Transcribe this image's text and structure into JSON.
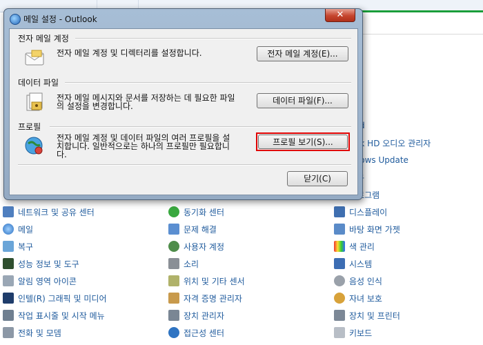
{
  "dialog": {
    "title": "메일 설정 - Outlook",
    "close_glyph": "✕",
    "sections": [
      {
        "title": "전자 메일 계정",
        "desc": [
          "전자 메일 계정 및 디렉터리를 설정합니다."
        ],
        "button": "전자 메일 계정(E)..."
      },
      {
        "title": "데이터 파일",
        "desc": [
          "전자 메일 메시지와 문서를 저장하는 데 필요한 파일",
          "의 설정을 변경합니다."
        ],
        "button": "데이터 파일(F)..."
      },
      {
        "title": "프로필",
        "desc": [
          "전자 메일 계정 및 데이터 파일의 여러 프로필을 설",
          "치합니다. 일반적으로는 하나의 프로필만 필요합니",
          "다."
        ],
        "button": "프로필 보기(S)..."
      }
    ],
    "close_button": "닫기(C)"
  },
  "control_panel": {
    "partial_items": [
      "oud",
      "ltek HD 오디오 관리자",
      "ndows Update",
      "도구",
      "프로그램"
    ],
    "columns": [
      [
        {
          "label": "네트워크 및 공유 센터",
          "icon": "network-icon"
        },
        {
          "label": "메일",
          "icon": "mail-icon"
        },
        {
          "label": "복구",
          "icon": "recovery-icon"
        },
        {
          "label": "성능 정보 및 도구",
          "icon": "performance-icon"
        },
        {
          "label": "알림 영역 아이콘",
          "icon": "notification-icon"
        },
        {
          "label": "인텔(R) 그래픽 및 미디어",
          "icon": "intel-graphics-icon"
        },
        {
          "label": "작업 표시줄 및 시작 메뉴",
          "icon": "taskbar-icon"
        },
        {
          "label": "전화 및 모뎀",
          "icon": "phone-icon"
        }
      ],
      [
        {
          "label": "동기화 센터",
          "icon": "sync-icon"
        },
        {
          "label": "문제 해결",
          "icon": "troubleshoot-icon"
        },
        {
          "label": "사용자 계정",
          "icon": "user-accounts-icon"
        },
        {
          "label": "소리",
          "icon": "sound-icon"
        },
        {
          "label": "위치 및 기타 센서",
          "icon": "sensor-icon"
        },
        {
          "label": "자격 증명 관리자",
          "icon": "credential-icon"
        },
        {
          "label": "장치 관리자",
          "icon": "device-manager-icon"
        },
        {
          "label": "접근성 센터",
          "icon": "accessibility-icon"
        }
      ],
      [
        {
          "label": "디스플레이",
          "icon": "display-icon"
        },
        {
          "label": "바탕 화면 가젯",
          "icon": "gadgets-icon"
        },
        {
          "label": "색 관리",
          "icon": "color-icon"
        },
        {
          "label": "시스템",
          "icon": "system-icon"
        },
        {
          "label": "음성 인식",
          "icon": "speech-icon"
        },
        {
          "label": "자녀 보호",
          "icon": "parental-icon"
        },
        {
          "label": "장치 및 프린터",
          "icon": "printer-icon"
        },
        {
          "label": "키보드",
          "icon": "keyboard-icon"
        }
      ]
    ]
  }
}
